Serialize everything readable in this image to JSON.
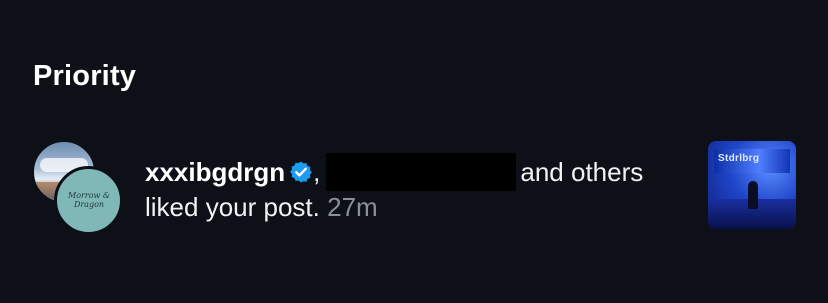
{
  "section": {
    "title": "Priority"
  },
  "notification": {
    "username": "xxxibgdrgn",
    "separator": ",",
    "others_text": "and others",
    "action_text": "liked your post.",
    "time": "27m",
    "verified_icon": "verified-badge-icon",
    "redacted_user": "redacted",
    "avatar_signature": "Morrow & Dragon",
    "post_thumbnail_text": "Stdrlbrg"
  },
  "colors": {
    "background": "#0d1017",
    "text_primary": "#ffffff",
    "text_secondary": "#8a8f99",
    "verified_blue": "#1d9bf0"
  }
}
